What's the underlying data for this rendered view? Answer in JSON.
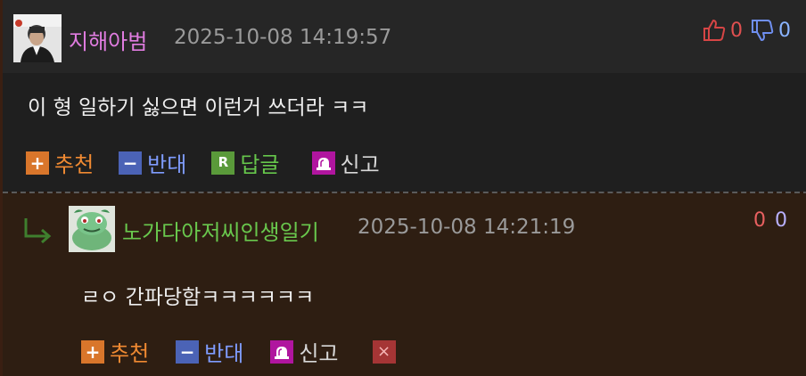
{
  "comments": [
    {
      "nickname": "지해아범",
      "timestamp": "2025-10-08 14:19:57",
      "text": "이 형 일하기 싫으면 이런거 쓰더라 ㅋㅋ",
      "upvotes": "0",
      "downvotes": "0",
      "actions": {
        "recommend": "추천",
        "oppose": "반대",
        "reply": "답글",
        "report": "신고"
      },
      "icons": {
        "recommend": "plus-icon",
        "oppose": "minus-icon",
        "reply": "r-reply-icon",
        "report": "siren-icon",
        "up": "thumbs-up-icon",
        "down": "thumbs-down-icon"
      }
    },
    {
      "nickname": "노가다아저씨인생일기",
      "timestamp": "2025-10-08 14:21:19",
      "text": "ㄹㅇ 간파당함ㅋㅋㅋㅋㅋㅋ",
      "upvotes": "0",
      "downvotes": "0",
      "actions": {
        "recommend": "추천",
        "oppose": "반대",
        "report": "신고",
        "delete": "×"
      },
      "icons": {
        "reply_marker": "reply-arrow-icon",
        "recommend": "plus-icon",
        "oppose": "minus-icon",
        "report": "siren-icon",
        "delete": "close-icon"
      }
    }
  ],
  "colors": {
    "nickname_1": "#e07ce0",
    "nickname_2": "#69c84d",
    "recommend": "#f08a32",
    "oppose": "#7f9cff",
    "reply": "#66c64b",
    "upvote": "#e05050",
    "downvote": "#8ab4ff"
  }
}
